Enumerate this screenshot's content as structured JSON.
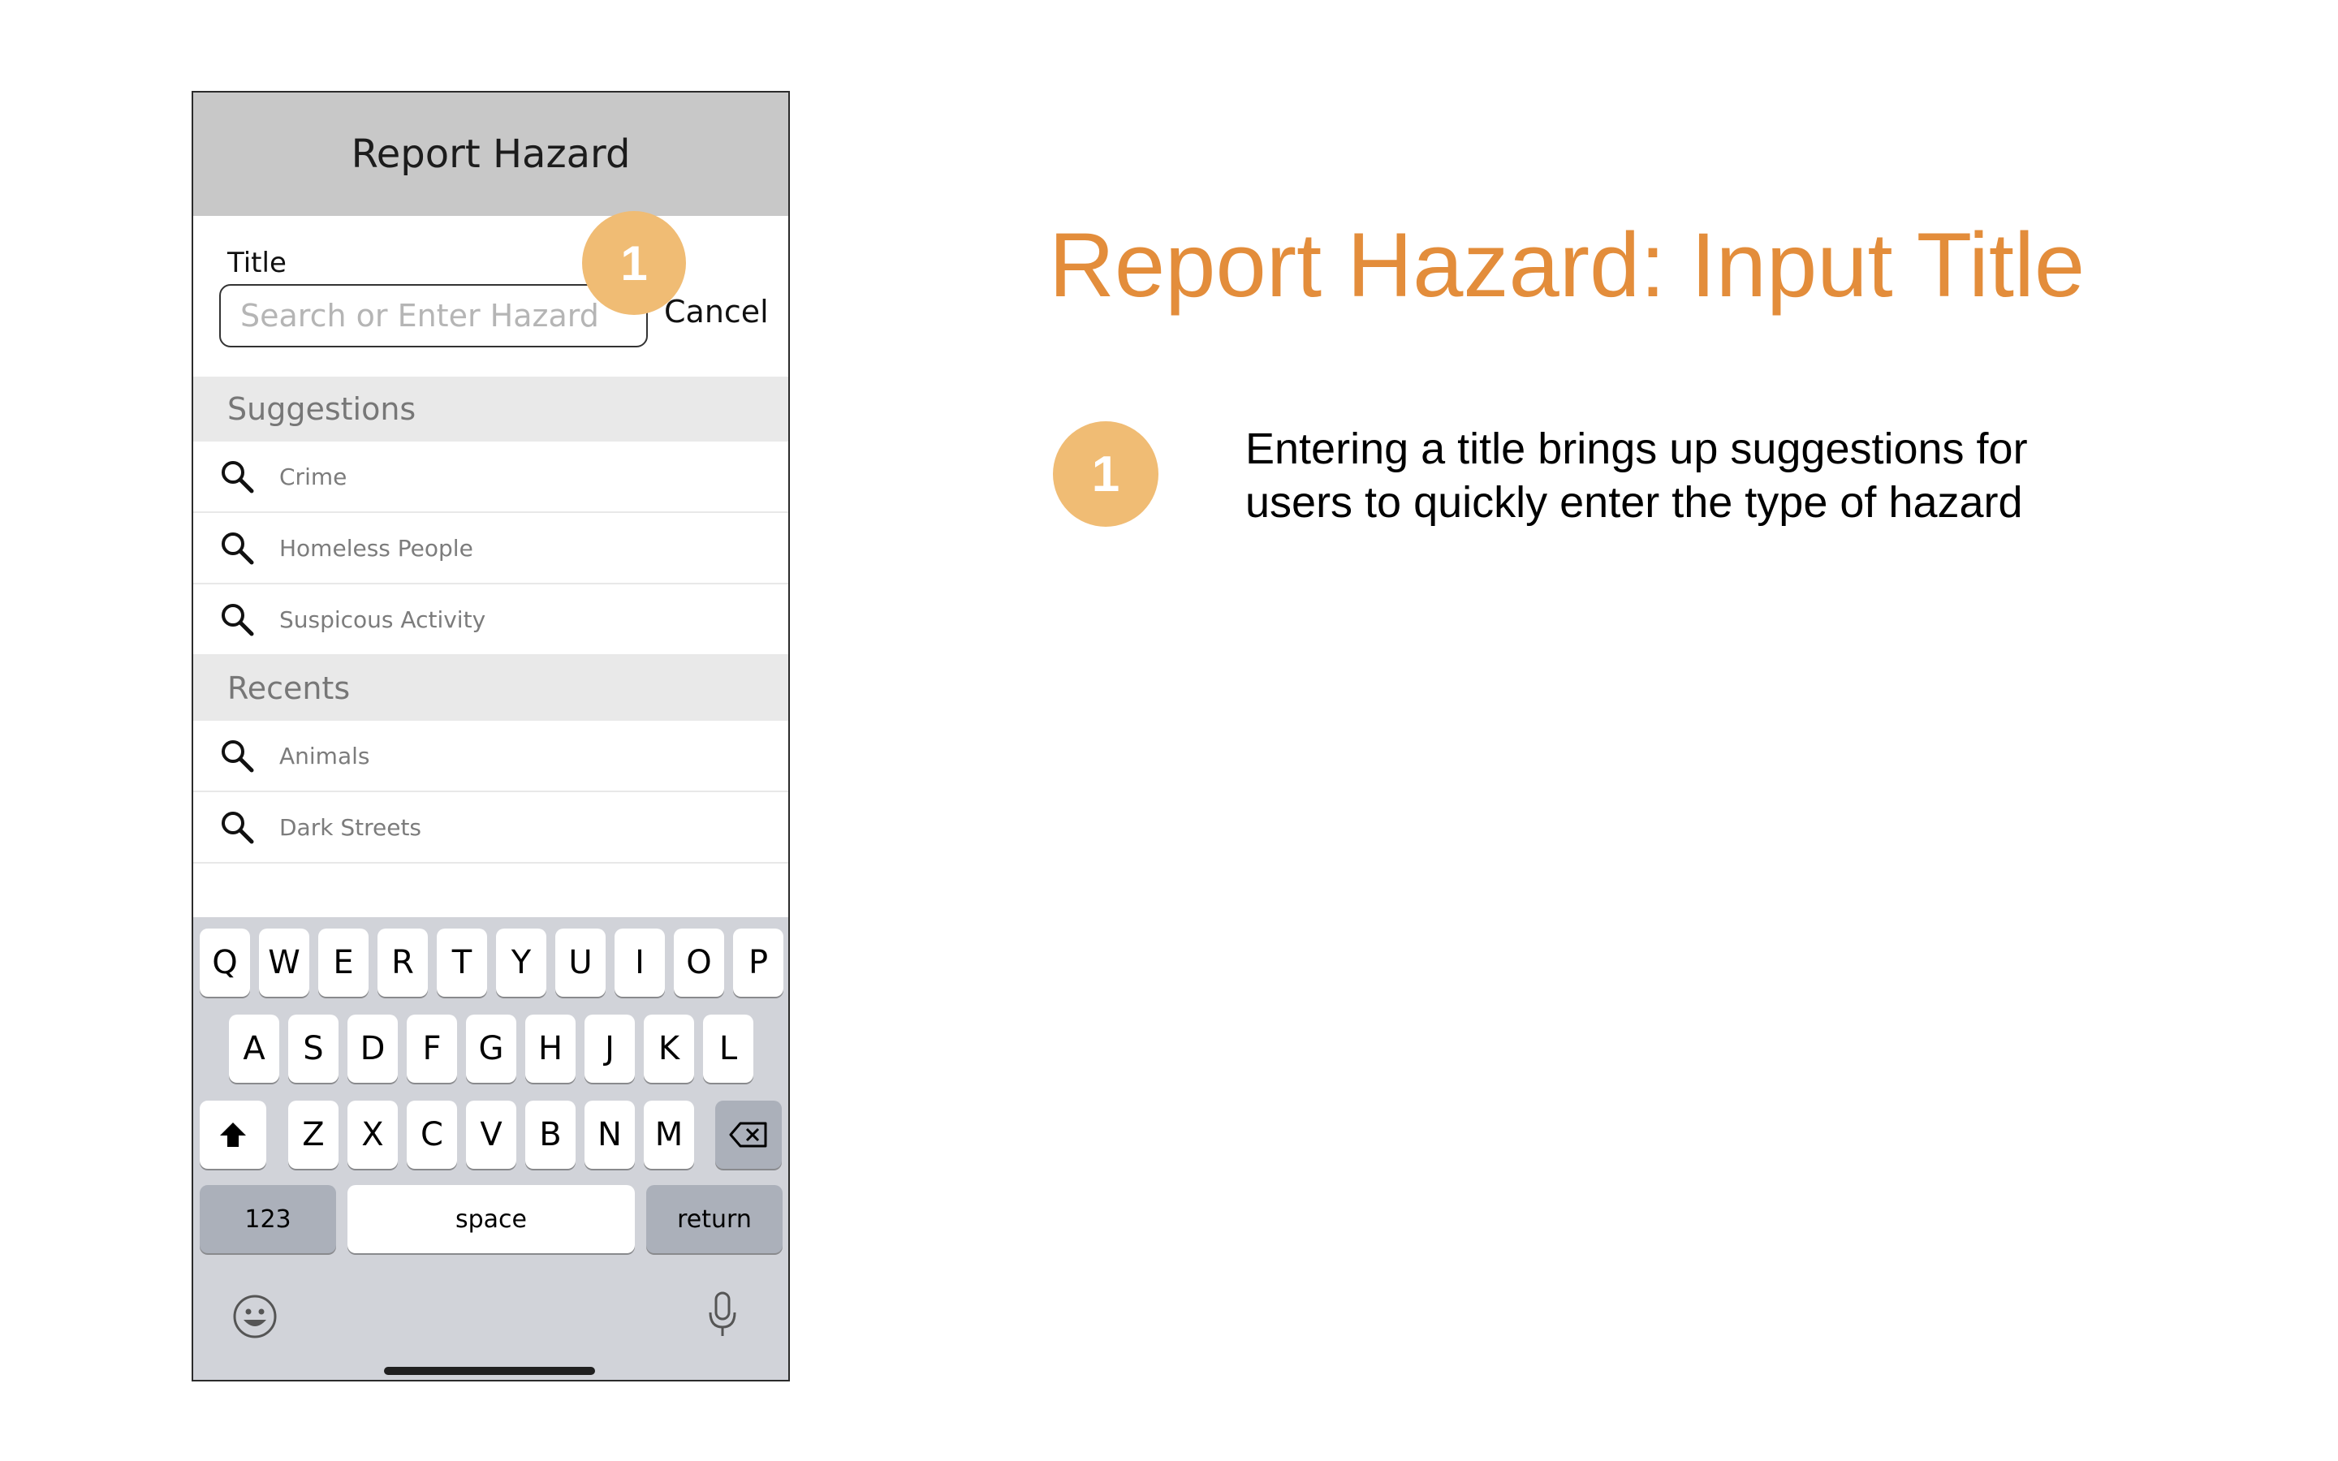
{
  "phone": {
    "nav_title": "Report Hazard",
    "title_label": "Title",
    "search": {
      "placeholder": "Search or Enter Hazard",
      "value": ""
    },
    "cancel_label": "Cancel",
    "badge": "1",
    "suggestions": {
      "header": "Suggestions",
      "items": [
        {
          "label": "Crime",
          "icon": "search-icon"
        },
        {
          "label": "Homeless People",
          "icon": "search-icon"
        },
        {
          "label": "Suspicous Activity",
          "icon": "search-icon"
        }
      ]
    },
    "recents": {
      "header": "Recents",
      "items": [
        {
          "label": "Animals",
          "icon": "search-icon"
        },
        {
          "label": "Dark Streets",
          "icon": "search-icon"
        }
      ]
    },
    "keyboard": {
      "row1": [
        "Q",
        "W",
        "E",
        "R",
        "T",
        "Y",
        "U",
        "I",
        "O",
        "P"
      ],
      "row2": [
        "A",
        "S",
        "D",
        "F",
        "G",
        "H",
        "J",
        "K",
        "L"
      ],
      "row3": [
        "Z",
        "X",
        "C",
        "V",
        "B",
        "N",
        "M"
      ],
      "shift_icon": "shift-icon",
      "delete_icon": "backspace-icon",
      "numbers_label": "123",
      "space_label": "space",
      "return_label": "return",
      "emoji_icon": "emoji-icon",
      "mic_icon": "microphone-icon"
    }
  },
  "annotation": {
    "title": "Report Hazard: Input Title",
    "badge": "1",
    "note": "Entering a title brings up suggestions for users to quickly enter the type of hazard"
  },
  "colors": {
    "accent": "#e38d3b",
    "badge": "#f0bc74",
    "nav_bar": "#c8c8c8",
    "section_header": "#e9e9e9",
    "keyboard_bg": "#d1d3d9"
  }
}
